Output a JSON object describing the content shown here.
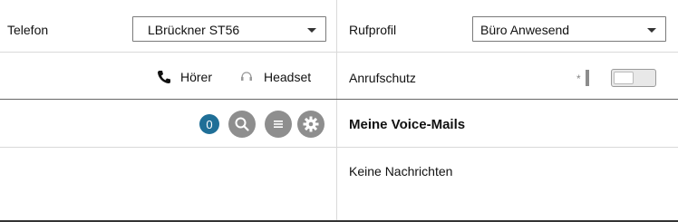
{
  "telefon": {
    "label": "Telefon",
    "selected": "LBrückner ST56"
  },
  "rufprofil": {
    "label": "Rufprofil",
    "selected": "Büro Anwesend"
  },
  "audio": {
    "hoerer_label": "Hörer",
    "headset_label": "Headset"
  },
  "anrufschutz": {
    "label": "Anrufschutz",
    "enabled": false
  },
  "toolbar": {
    "badge_count": "0",
    "icons": [
      "search-icon",
      "list-icon",
      "gear-icon"
    ]
  },
  "voicemail": {
    "title": "Meine Voice-Mails",
    "empty_text": "Keine Nachrichten"
  },
  "colors": {
    "badge": "#1f6f97",
    "icon_circle": "#8e8e8e"
  }
}
